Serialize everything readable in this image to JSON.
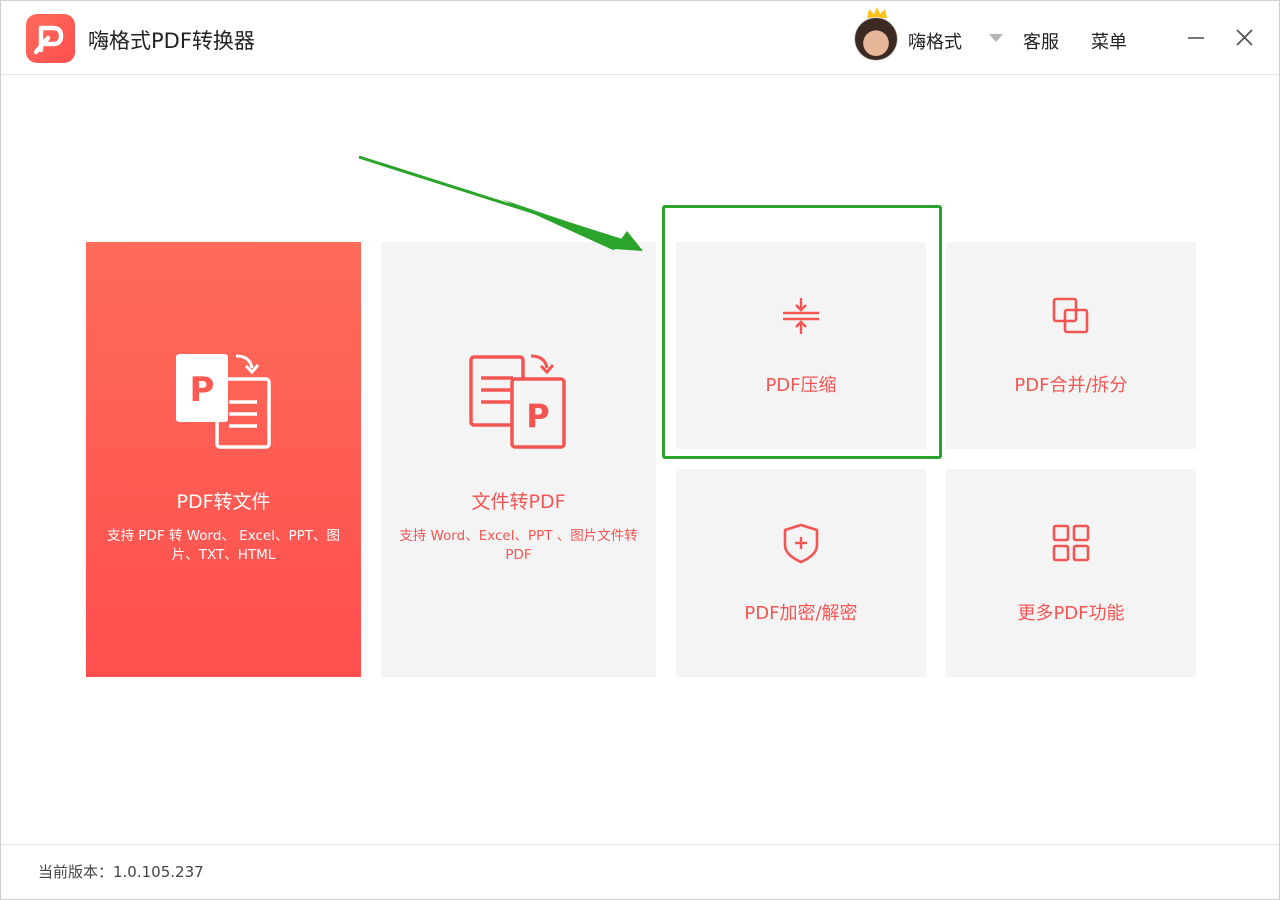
{
  "app": {
    "title": "嗨格式PDF转换器",
    "logo_icon": "pdf-logo-icon"
  },
  "header": {
    "username": "嗨格式",
    "support_label": "客服",
    "menu_label": "菜单"
  },
  "cards": {
    "pdf_to_file": {
      "title": "PDF转文件",
      "description": "支持 PDF 转 Word、 Excel、PPT、图片、TXT、HTML",
      "icon": "pdf-to-file-icon"
    },
    "file_to_pdf": {
      "title": "文件转PDF",
      "description": "支持 Word、Excel、PPT 、图片文件转 PDF",
      "icon": "file-to-pdf-icon"
    },
    "compress": {
      "title": "PDF压缩",
      "icon": "compress-icon"
    },
    "merge_split": {
      "title": "PDF合并/拆分",
      "icon": "merge-icon"
    },
    "encrypt": {
      "title": "PDF加密/解密",
      "icon": "shield-icon"
    },
    "more": {
      "title": "更多PDF功能",
      "icon": "grid-icon"
    }
  },
  "footer": {
    "version": "当前版本：1.0.105.237"
  },
  "colors": {
    "brand": "#ff5a52",
    "accent_text": "#f35553",
    "card_bg": "#f4f4f4",
    "annotation": "#2aa42a"
  }
}
